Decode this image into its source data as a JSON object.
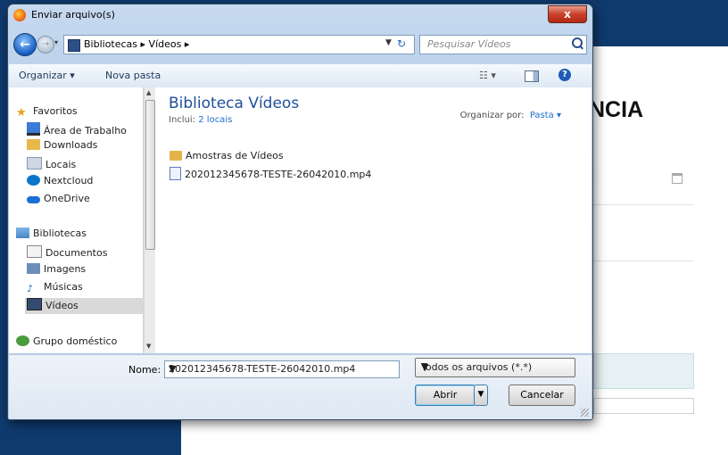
{
  "background_page": {
    "heading_partial": "NCIA"
  },
  "dialog": {
    "title": "Enviar arquivo(s)",
    "close_label": "x",
    "address": {
      "path": "Bibliotecas  ▸  Vídeos  ▸",
      "search_placeholder": "Pesquisar Vídeos"
    },
    "toolbar": {
      "organize": "Organizar ▾",
      "new_folder": "Nova pasta",
      "views": "☷ ▾",
      "help": "?"
    },
    "nav": {
      "favorites_header": "Favoritos",
      "favorites": [
        "Área de Trabalho",
        "Downloads",
        "Locais",
        "Nextcloud",
        "OneDrive"
      ],
      "libraries_header": "Bibliotecas",
      "libraries": [
        "Documentos",
        "Imagens",
        "Músicas",
        "Vídeos"
      ],
      "homegroup": "Grupo doméstico",
      "selected": "Vídeos"
    },
    "content": {
      "title": "Biblioteca Vídeos",
      "includes_label": "Inclui:",
      "includes_link": "2 locais",
      "arrange_label": "Organizar por:",
      "arrange_value": "Pasta ▾",
      "items": [
        {
          "type": "folder",
          "name": "Amostras de Vídeos"
        },
        {
          "type": "video",
          "name": "202012345678-TESTE-26042010.mp4"
        }
      ]
    },
    "footer": {
      "name_label": "Nome:",
      "name_value": "202012345678-TESTE-26042010.mp4",
      "filter_value": "Todos os arquivos (*.*)",
      "open_label": "Abrir",
      "cancel_label": "Cancelar"
    }
  },
  "colors": {
    "page_navy": "#0f3a6e",
    "library_title": "#1e4f9c",
    "link": "#1f6fd1"
  }
}
